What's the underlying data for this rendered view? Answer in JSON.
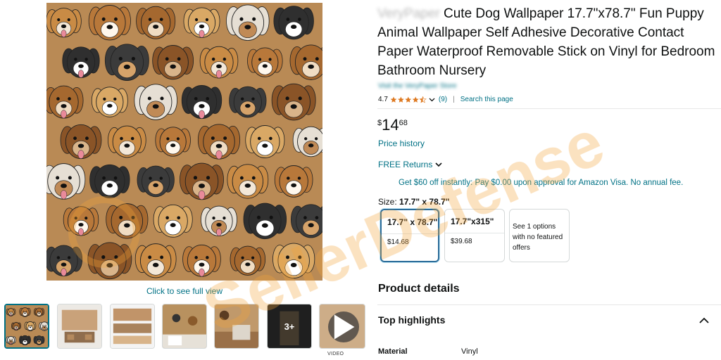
{
  "gallery": {
    "full_view_link": "Click to see full view",
    "more_images_badge": "3+",
    "video_label": "VIDEO"
  },
  "product": {
    "brand": "VeryPaper",
    "title": "Cute Dog Wallpaper 17.7\"x78.7\" Fun Puppy Animal Wallpaper Self Adhesive Decorative Contact Paper Waterproof Removable Stick on Vinyl for Bedroom Bathroom Nursery",
    "store_link": "Visit the VeryPaper Store",
    "rating": "4.7",
    "rating_stars": 4.5,
    "review_count": "(9)",
    "search_page": "Search this page",
    "price_symbol": "$",
    "price_whole": "14",
    "price_fraction": "68",
    "price_history": "Price history",
    "free_returns": "FREE Returns",
    "promo": "Get $60 off instantly: Pay $0.00 upon approval for Amazon Visa. No annual fee.",
    "size_label": "Size:",
    "size_selected": "17.7\" x 78.7\""
  },
  "size_options": [
    {
      "name": "17.7\" x 78.7\"",
      "price": "$14.68"
    },
    {
      "name": "17.7\"x315\"",
      "price": "$39.68"
    }
  ],
  "no_featured_offer": "See 1 options with no featured offers",
  "sections": {
    "product_details": "Product details",
    "top_highlights": "Top highlights",
    "spec_label": "Material",
    "spec_value": "Vinyl"
  },
  "watermark": "SellerDefense",
  "colors": {
    "link": "#007185",
    "star": "#de7921",
    "selected_border": "#2b6c99",
    "watermark": "#f2a33a"
  }
}
